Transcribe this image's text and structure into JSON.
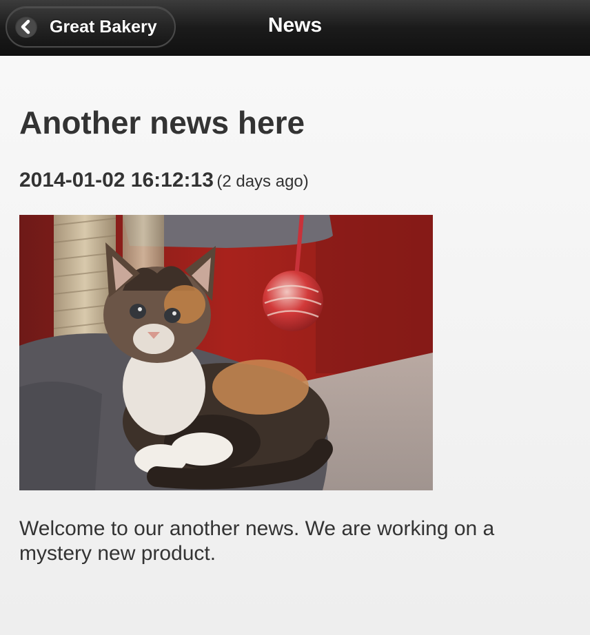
{
  "header": {
    "back_label": "Great Bakery",
    "title": "News"
  },
  "article": {
    "title": "Another news here",
    "date": "2014-01-02 16:12:13",
    "relative_time": "(2 days ago)",
    "image_subject": "kitten",
    "body": "Welcome to our another news. We are working on a mystery new product."
  },
  "icons": {
    "back": "chevron-left-icon"
  },
  "colors": {
    "header_bg": "#1b1b1b",
    "page_bg": "#f5f5f5",
    "text": "#333333",
    "header_text": "#ffffff"
  }
}
